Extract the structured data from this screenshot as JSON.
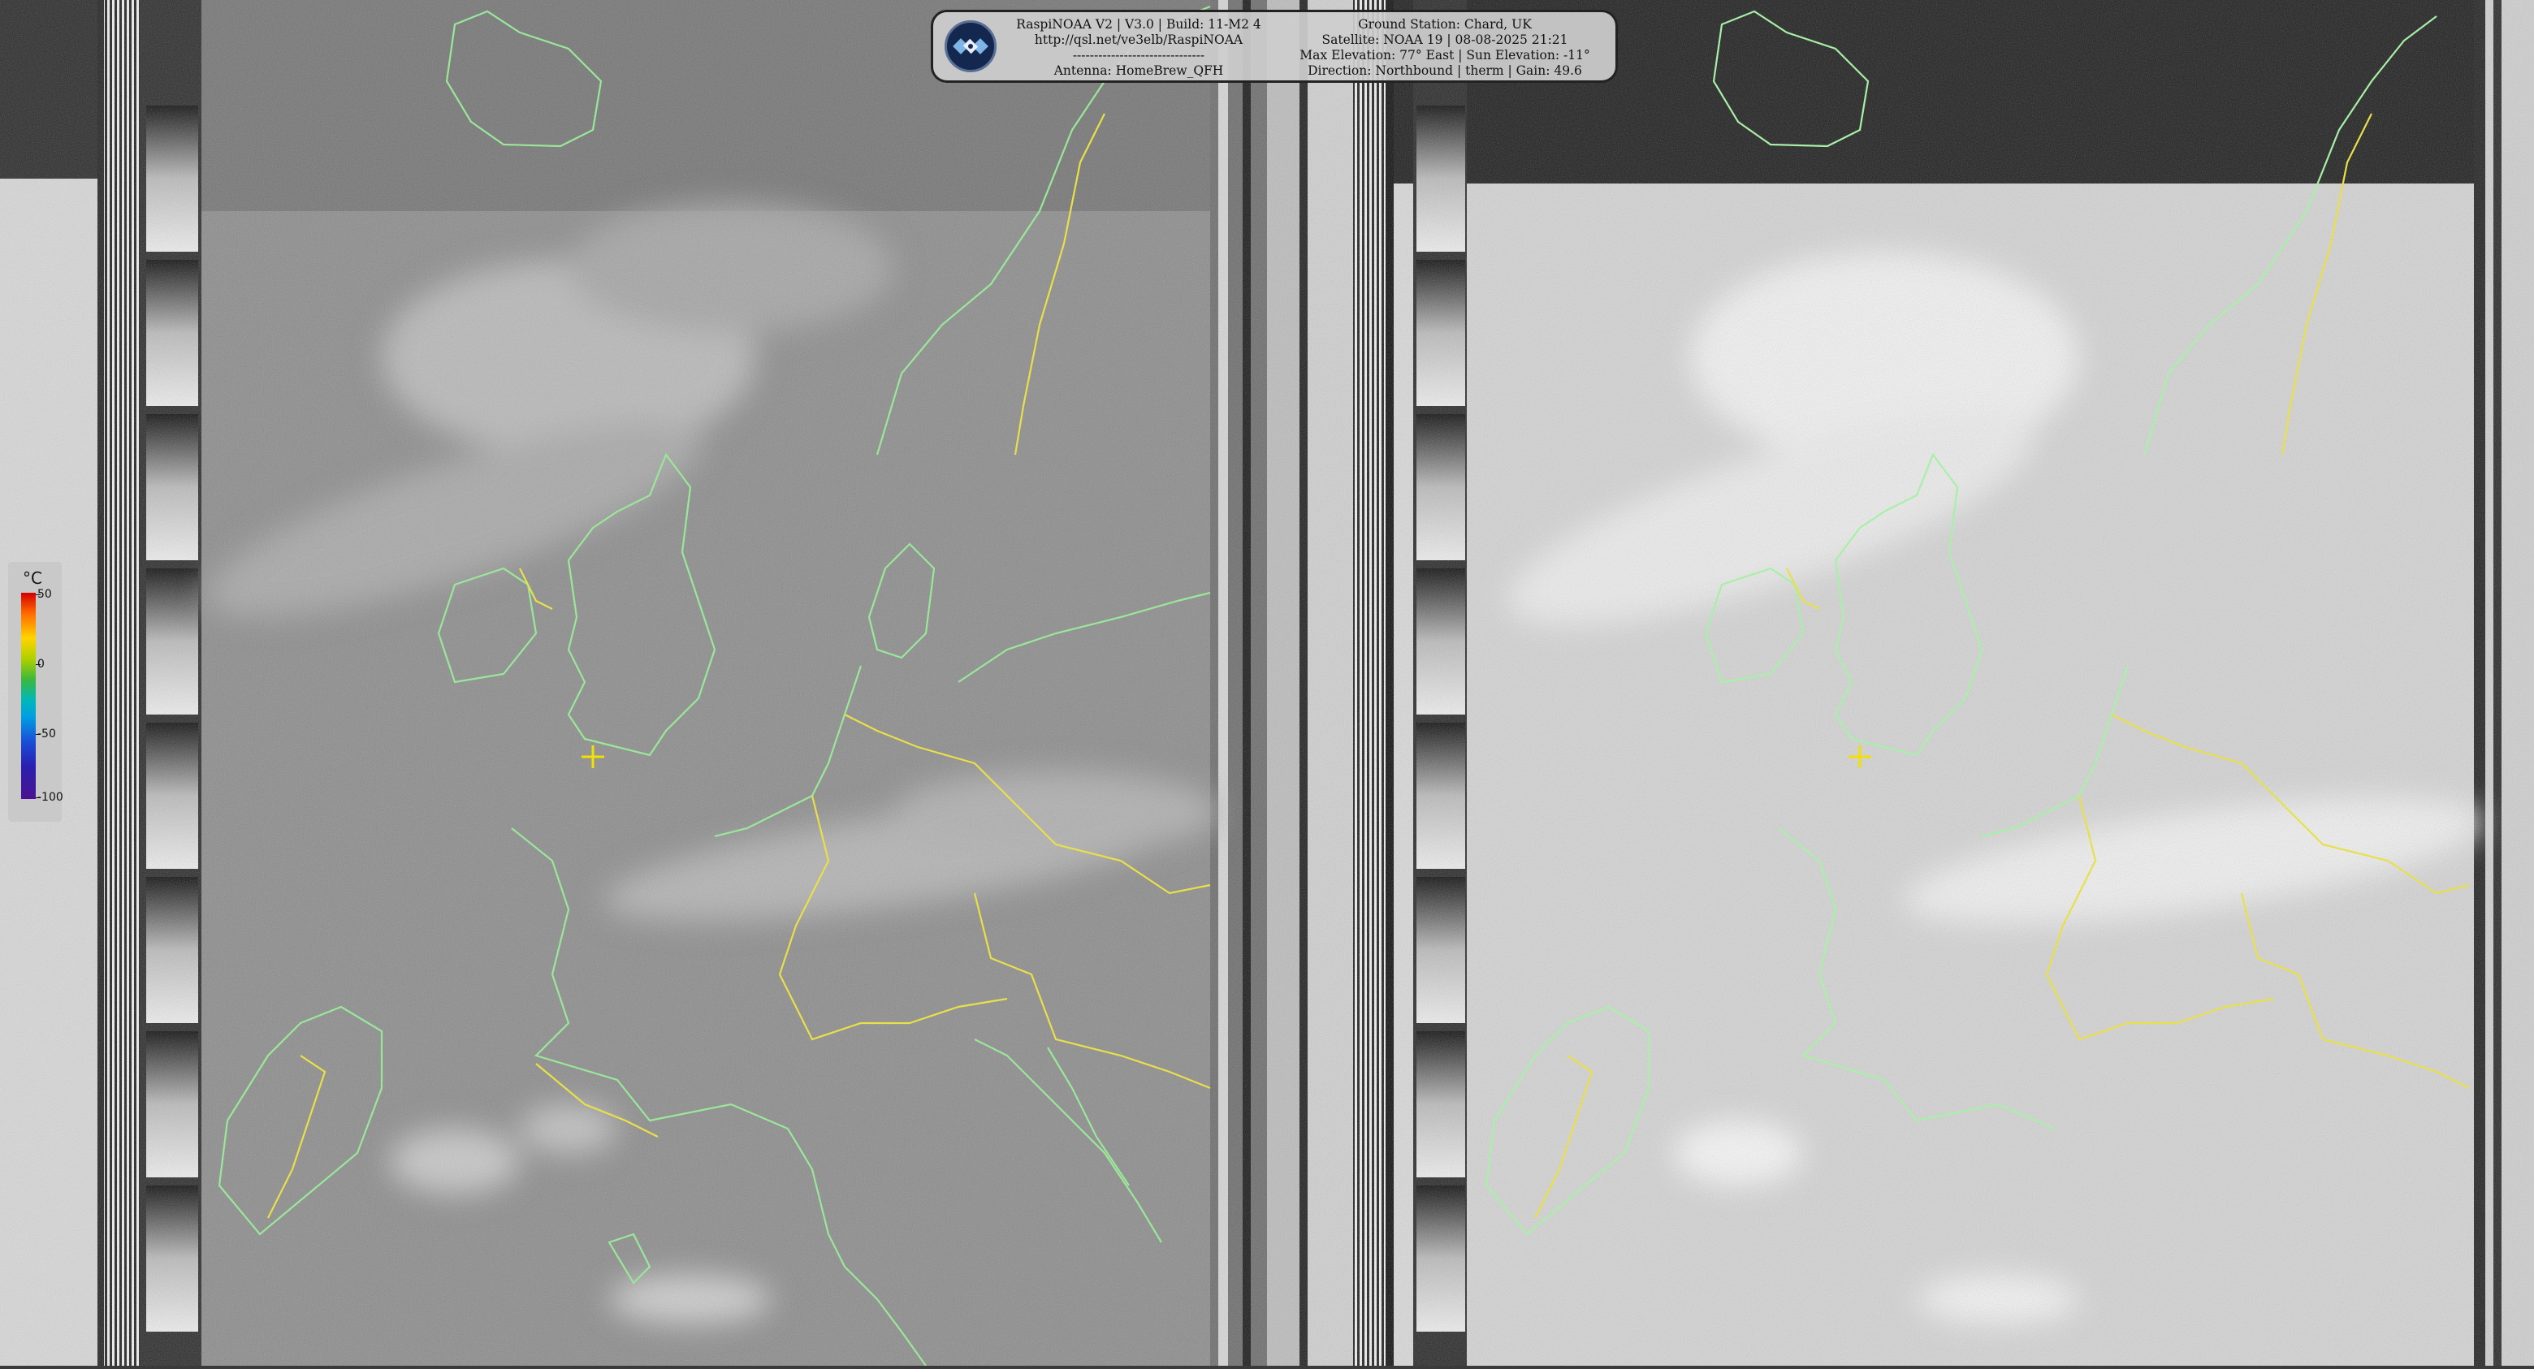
{
  "header": {
    "line1_left": "RaspiNOAA V2 | V3.0 | Build: 11-M2 4",
    "line2_left": "http://qsl.net/ve3elb/RaspiNOAA",
    "line3_left": "-------------------------------",
    "line4_left": "Antenna: HomeBrew_QFH",
    "line1_right": "Ground Station: Chard, UK",
    "line2_right": "Satellite: NOAA 19 | 08-08-2025 21:21",
    "line3_right": "Max Elevation: 77° East | Sun Elevation: -11°",
    "line4_right": "Direction: Northbound | therm | Gain: 49.6"
  },
  "legend": {
    "unit": "°C",
    "ticks": [
      "50",
      "0",
      "-50",
      "-100"
    ]
  },
  "colors": {
    "coast": "#9ae79a",
    "border": "#e8e04a",
    "marker": "#f2e000",
    "logo_bg": "#14284f"
  },
  "icons": {
    "logo": "satellite-icon",
    "ground_station": "crosshair-marker-icon"
  }
}
